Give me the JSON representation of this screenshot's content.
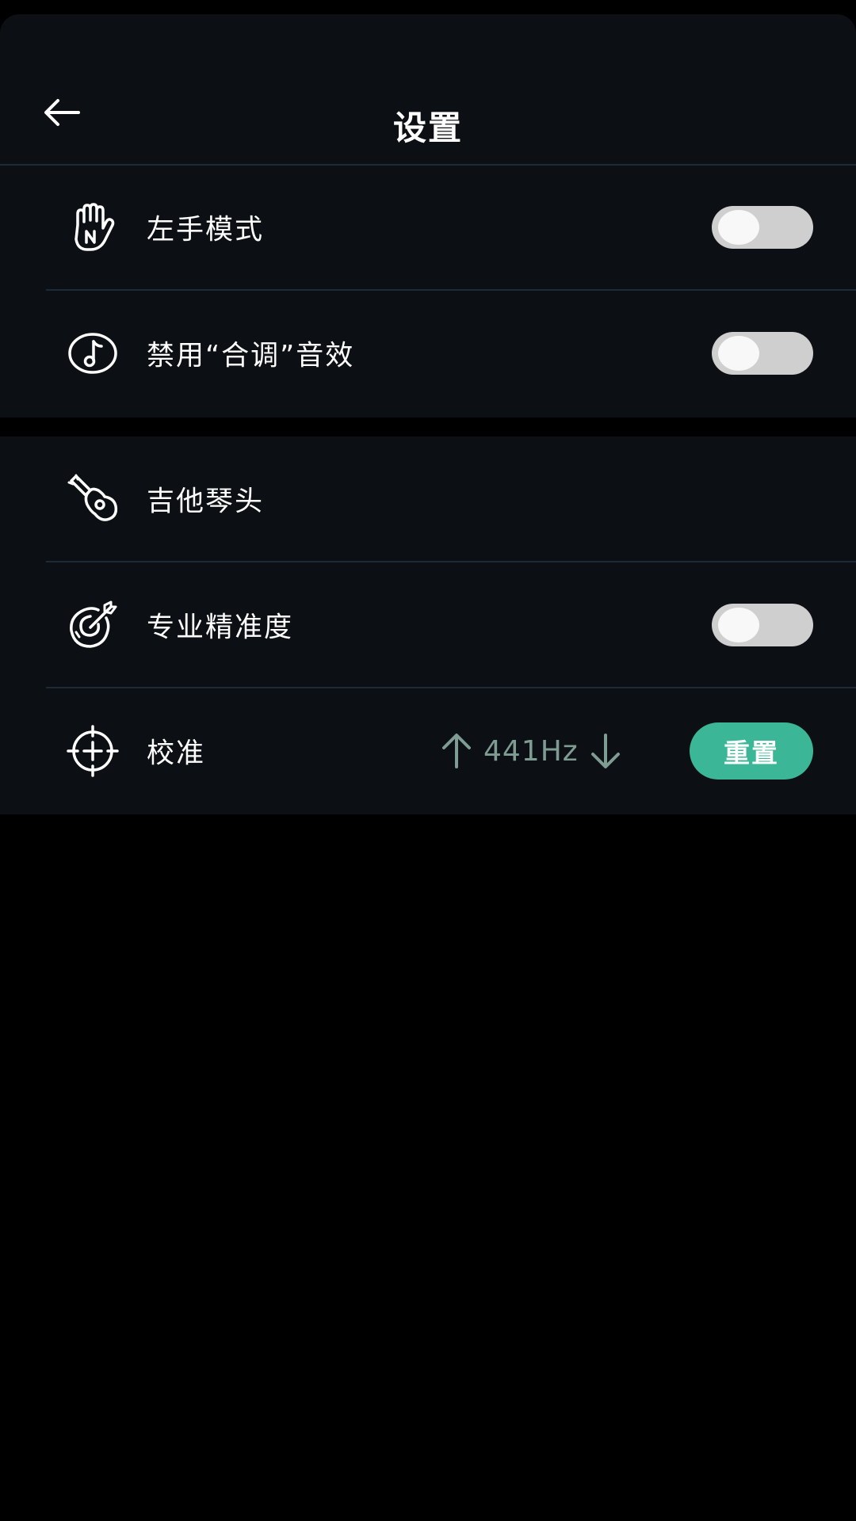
{
  "header": {
    "title": "设置"
  },
  "settings": {
    "left_hand": {
      "label": "左手模式",
      "enabled": false
    },
    "disable_sound": {
      "label": "禁用“合调”音效",
      "enabled": false
    },
    "headstock": {
      "label": "吉他琴头"
    },
    "pro_precision": {
      "label": "专业精准度",
      "enabled": false
    },
    "calibration": {
      "label": "校准",
      "value": "441Hz",
      "reset_label": "重置"
    }
  },
  "colors": {
    "background": "#000000",
    "panel": "#0c0f13",
    "divider": "#1e2a36",
    "accent": "#3bb696",
    "muted_accent": "#7e9c92",
    "toggle_off": "#cfcfcf"
  },
  "icons": {
    "back": "arrow-left-icon",
    "left_hand": "hand-icon",
    "disable_sound": "music-note-icon",
    "headstock": "guitar-icon",
    "pro_precision": "target-icon",
    "calibration": "crosshair-icon",
    "increase": "arrow-up-icon",
    "decrease": "arrow-down-icon"
  }
}
